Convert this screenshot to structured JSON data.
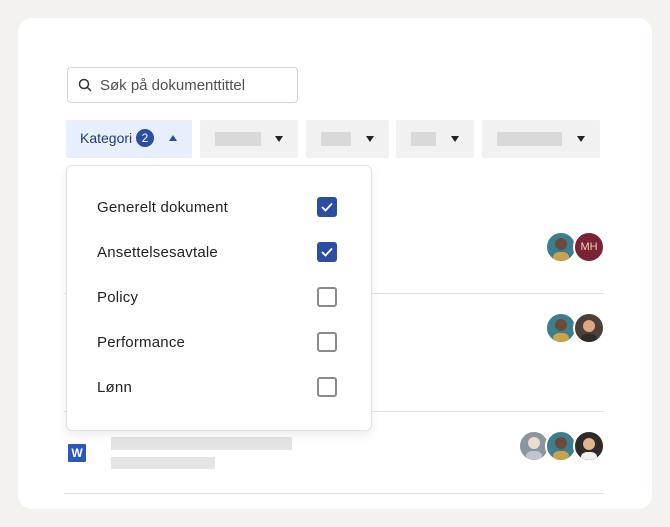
{
  "search": {
    "placeholder": "Søk på dokumenttittel"
  },
  "filters": {
    "category_label": "Kategori",
    "category_count": "2"
  },
  "dropdown": {
    "options": [
      {
        "label": "Generelt dokument",
        "checked": true
      },
      {
        "label": "Ansettelsesavtale",
        "checked": true
      },
      {
        "label": "Policy",
        "checked": false
      },
      {
        "label": "Performance",
        "checked": false
      },
      {
        "label": "Lønn",
        "checked": false
      }
    ]
  },
  "rows": [
    {
      "avatars": [
        "person",
        "MH"
      ]
    },
    {
      "avatars": [
        "person",
        "person"
      ]
    },
    {
      "file_icon": "W",
      "avatars": [
        "person",
        "person",
        "person"
      ]
    }
  ],
  "colors": {
    "accent": "#2b4ea3",
    "active_filter_bg": "#e7eefc"
  }
}
